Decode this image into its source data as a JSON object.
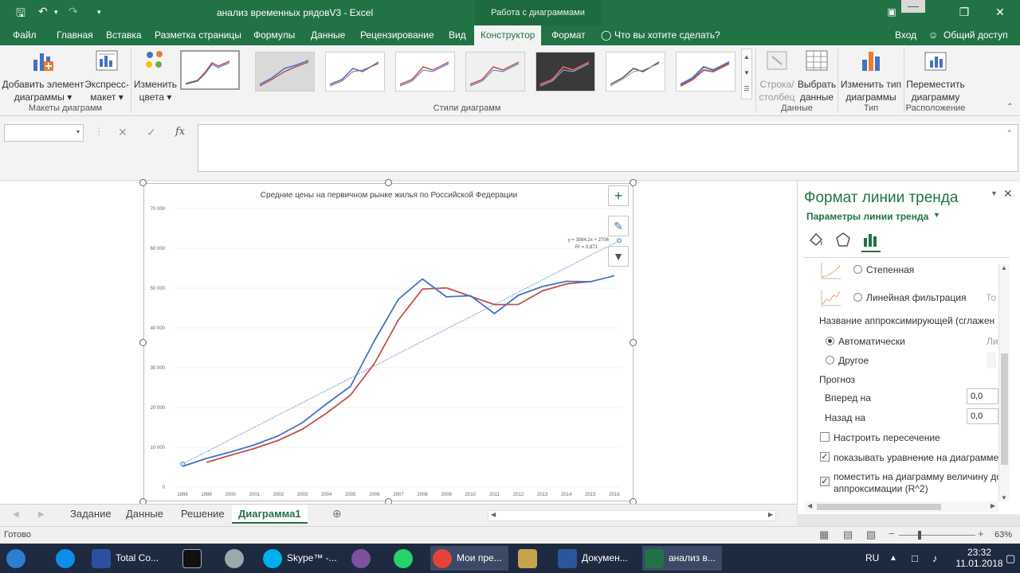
{
  "window": {
    "title": "анализ временных рядовV3 - Excel",
    "context_tab": "Работа с диаграммами"
  },
  "tabs": [
    {
      "label": "Файл"
    },
    {
      "label": "Главная"
    },
    {
      "label": "Вставка"
    },
    {
      "label": "Разметка страницы"
    },
    {
      "label": "Формулы"
    },
    {
      "label": "Данные"
    },
    {
      "label": "Рецензирование"
    },
    {
      "label": "Вид"
    },
    {
      "label": "Конструктор"
    },
    {
      "label": "Формат"
    }
  ],
  "tell_me": "Что вы хотите сделать?",
  "signin": "Вход",
  "share": "Общий доступ",
  "ribbon": {
    "add_element": [
      "Добавить элемент",
      "диаграммы"
    ],
    "quick_layout": [
      "Экспресс-",
      "макет"
    ],
    "change_colors": [
      "Изменить",
      "цвета"
    ],
    "switch_rowcol": [
      "Строка/",
      "столбец"
    ],
    "select_data": [
      "Выбрать",
      "данные"
    ],
    "change_type": [
      "Изменить тип",
      "диаграммы"
    ],
    "move_chart": [
      "Переместить",
      "диаграмму"
    ],
    "groups": {
      "layouts": "Макеты диаграмм",
      "styles": "Стили диаграмм",
      "data": "Данные",
      "type": "Тип",
      "location": "Расположение"
    }
  },
  "formula_bar": {
    "fx": "fx"
  },
  "chart_data": {
    "type": "line",
    "title": "Средние цены на первичном рынке жилья по Российской Федерации",
    "categories": [
      "1998",
      "1999",
      "2000",
      "2001",
      "2002",
      "2003",
      "2004",
      "2005",
      "2006",
      "2007",
      "2008",
      "2009",
      "2010",
      "2011",
      "2012",
      "2013",
      "2014",
      "2015",
      "2016"
    ],
    "series": [
      {
        "values": [
          5200,
          7200,
          8800,
          10600,
          12900,
          16200,
          20900,
          25300,
          36800,
          47200,
          52300,
          47800,
          48100,
          43600,
          48200,
          50400,
          51700,
          51600,
          53100
        ]
      },
      {
        "values": [
          null,
          6200,
          8000,
          9700,
          11750,
          14550,
          18550,
          23100,
          31050,
          42000,
          49750,
          50050,
          47950,
          45850,
          45900,
          49300,
          51050,
          51650,
          null
        ]
      },
      {
        "values": [
          null,
          null,
          null,
          null,
          null,
          null,
          null,
          null,
          null,
          null,
          null,
          null,
          null,
          null,
          null,
          null,
          null,
          null,
          null
        ],
        "trend": {
          "slope": 3084.2,
          "intercept": 2706
        }
      }
    ],
    "colors": {
      "main": "#4472c4",
      "ma": "#c0504d",
      "trend": "#4472c4"
    },
    "ylim": [
      0,
      70000
    ],
    "yticks": [
      "0",
      "10 000",
      "20 000",
      "30 000",
      "40 000",
      "50 000",
      "60 000",
      "70 000"
    ],
    "trend_eq": "y = 3084,2x + 2706",
    "trend_r2": "R² = 0,871"
  },
  "pane": {
    "title": "Формат линии тренда",
    "subtitle": "Параметры линии тренда",
    "opt_power": "Степенная",
    "opt_linear_filter": "Линейная фильтрация",
    "opt_linear_filter_short": "То",
    "name_heading": "Название аппроксимирующей (сглажен",
    "opt_auto": "Автоматически",
    "opt_auto_right": "Ли",
    "opt_other": "Другое",
    "forecast": "Прогноз",
    "forward": "Вперед на",
    "forward_val": "0,0",
    "backward": "Назад на",
    "backward_val": "0,0",
    "intercept": "Настроить пересечение",
    "show_eq": "показывать уравнение на диаграмме",
    "show_r2_1": "поместить на диаграмму величину до",
    "show_r2_2": "аппроксимации (R^2)"
  },
  "sheets": [
    {
      "label": "Задание"
    },
    {
      "label": "Данные"
    },
    {
      "label": "Решение"
    },
    {
      "label": "Диаграмма1"
    }
  ],
  "status": {
    "ready": "Готово",
    "zoom": "63%"
  },
  "taskbar": {
    "items": [
      "Total Co...",
      "Skype™ -...",
      "Мои пре...",
      "Докумен...",
      "анализ в..."
    ],
    "lang": "RU",
    "time": "23:32",
    "date": "11.01.2018"
  }
}
